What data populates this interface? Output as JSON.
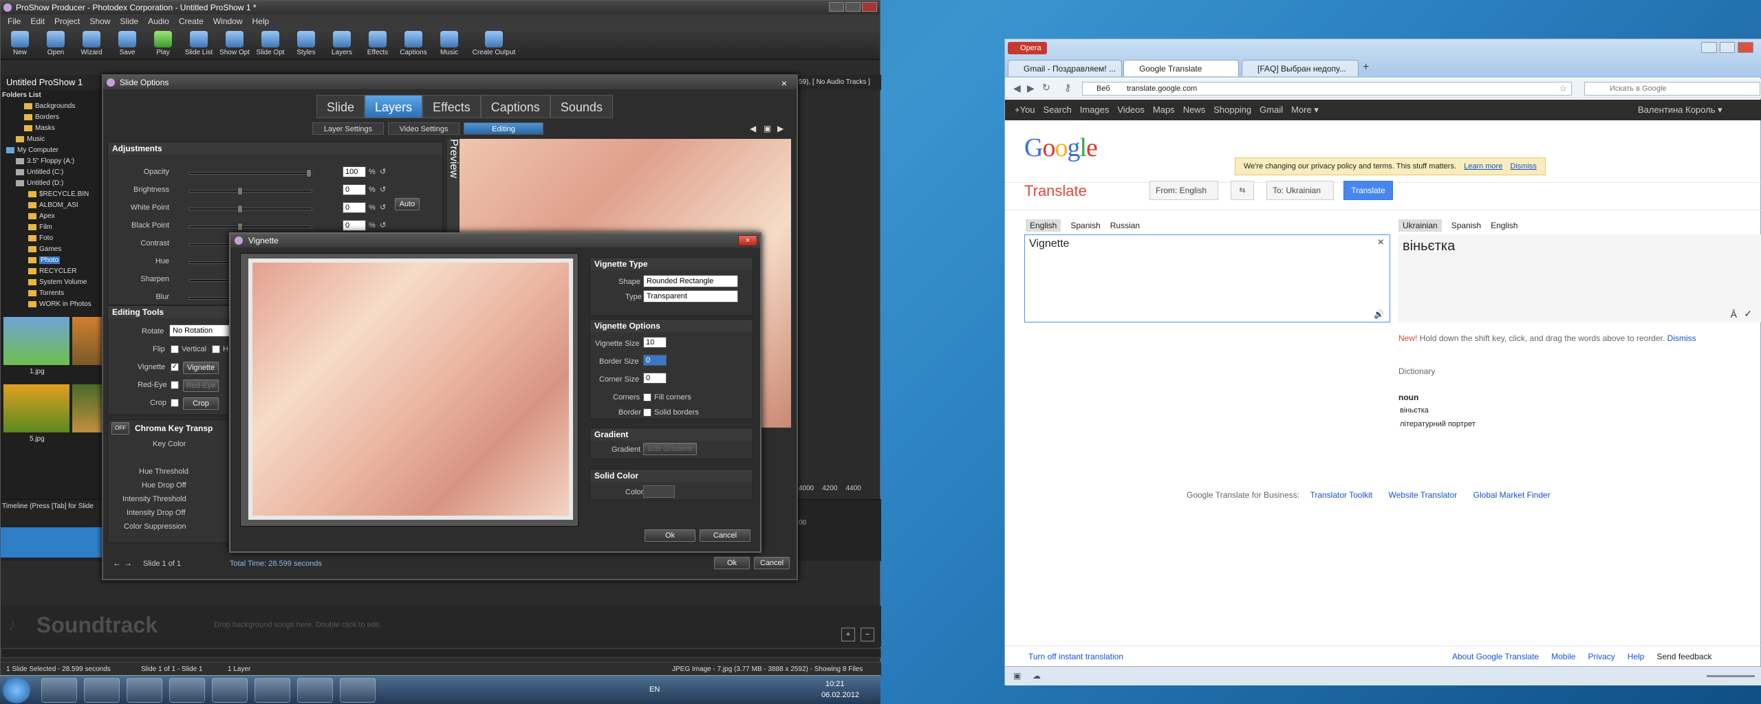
{
  "proshow": {
    "title": "ProShow Producer - Photodex Corporation - Untitled ProShow 1 *",
    "menu": [
      "File",
      "Edit",
      "Project",
      "Show",
      "Slide",
      "Audio",
      "Create",
      "Window",
      "Help"
    ],
    "toolbar": [
      "New",
      "Open",
      "Wizard",
      "Save",
      "Play",
      "Slide List",
      "Show Opt",
      "Slide Opt",
      "Styles",
      "Layers",
      "Effects",
      "Captions",
      "Music",
      "Create Output"
    ],
    "show_name": "Untitled ProShow 1",
    "show_info": "59), [ No Audio Tracks ]",
    "folders_title": "Folders List",
    "folders": [
      "Backgrounds",
      "Borders",
      "Masks",
      "Music",
      "My Computer",
      "3.5\" Floppy (A:)",
      "Untitled (C:)",
      "Untitled (D:)",
      "$RECYCLE.BIN",
      "ALBOM_ASI",
      "Apex",
      "Film",
      "Foto",
      "Games",
      "Photo",
      "RECYCLER",
      "System Volume",
      "Torrents",
      "WORK in Photos"
    ],
    "thumbs": [
      "1.jpg",
      "5.jpg"
    ],
    "timeline_label": "Timeline (Press [Tab] for Slide",
    "ruler": [
      "4000",
      "4200",
      "4400"
    ],
    "ruler_short": "00",
    "soundtrack": "Soundtrack",
    "soundtrack_hint": "Drop background songs here.  Double click to edit.",
    "status_left": "1 Slide Selected - 28.599 seconds",
    "status_mid": "Slide 1 of 1 - Slide 1",
    "status_layers": "1 Layer",
    "status_right": "JPEG Image - 7.jpg (3.77 MB - 3888 x 2592) - Showing 8 Files"
  },
  "slide_options": {
    "title": "Slide Options",
    "tabs": [
      "Slide",
      "Layers",
      "Effects",
      "Captions",
      "Sounds"
    ],
    "subtabs": [
      "Layer Settings",
      "Video Settings",
      "Editing"
    ],
    "preview_label": "Preview",
    "adjustments_title": "Adjustments",
    "adjust": [
      {
        "label": "Opacity",
        "value": "100",
        "unit": "%"
      },
      {
        "label": "Brightness",
        "value": "0",
        "unit": "%"
      },
      {
        "label": "White Point",
        "value": "0",
        "unit": "%"
      },
      {
        "label": "Black Point",
        "value": "0",
        "unit": "%"
      },
      {
        "label": "Contrast"
      },
      {
        "label": "Hue"
      },
      {
        "label": "Sharpen"
      },
      {
        "label": "Blur"
      }
    ],
    "auto": "Auto",
    "editing_tools": "Editing Tools",
    "rotate_label": "Rotate",
    "rotate_value": "No Rotation",
    "flip_label": "Flip",
    "vertical": "Vertical",
    "horizontal": "H",
    "vignette_label": "Vignette",
    "vignette_btn": "Vignette",
    "redeye_label": "Red-Eye",
    "redeye_btn": "Red-Eye",
    "crop_label": "Crop",
    "crop_btn": "Crop",
    "chroma_toggle": "OFF",
    "chroma": "Chroma Key Transp",
    "key_color": "Key Color",
    "chroma_rows": [
      "Hue Threshold",
      "Hue Drop Off",
      "Intensity Threshold",
      "Intensity Drop Off",
      "Color Suppression"
    ],
    "slide_nav": "Slide 1 of 1",
    "total_time": "Total Time: 28.599 seconds",
    "ok": "Ok",
    "cancel": "Cancel"
  },
  "vignette": {
    "title": "Vignette",
    "type_title": "Vignette Type",
    "shape_label": "Shape",
    "shape_value": "Rounded Rectangle",
    "type_label": "Type",
    "type_value": "Transparent",
    "options_title": "Vignette Options",
    "size_label": "Vignette Size",
    "size_value": "10",
    "border_label": "Border Size",
    "border_value": "0",
    "corner_label": "Corner Size",
    "corner_value": "0",
    "corners_label": "Corners",
    "fill_corners": "Fill corners",
    "border_chk_label": "Border",
    "solid_borders": "Solid borders",
    "gradient_title": "Gradient",
    "gradient_label": "Gradient",
    "gradient_btn": "Edit Gradient",
    "solid_title": "Solid Color",
    "color_label": "Color",
    "ok": "Ok",
    "cancel": "Cancel"
  },
  "opera": {
    "app": "Opera",
    "tabs": [
      "Gmail - Поздравляем! ...",
      "Google Translate",
      "[FAQ] Выбран недопу..."
    ],
    "back_label": "Веб",
    "url": "translate.google.com",
    "search_placeholder": "Искать в Google",
    "gbar": [
      "+You",
      "Search",
      "Images",
      "Videos",
      "Maps",
      "News",
      "Shopping",
      "Gmail",
      "More ▾"
    ],
    "user": "Валентина Король ▾",
    "notice": "We're changing our privacy policy and terms. This stuff matters.",
    "learn_more": "Learn more",
    "dismiss": "Dismiss",
    "translate_title": "Translate",
    "from": "From: English",
    "to": "To: Ukrainian",
    "translate_btn": "Translate",
    "src_langs": [
      "English",
      "Spanish",
      "Russian"
    ],
    "dst_langs": [
      "Ukrainian",
      "Spanish",
      "English"
    ],
    "source_text": "Vignette",
    "result": "віньєтка",
    "tip_new": "New!",
    "tip": "Hold down the shift key, click, and drag the words above to reorder.",
    "tip_dismiss": "Dismiss",
    "dictionary": "Dictionary",
    "pos": "noun",
    "meanings": [
      "віньєтка",
      "літературний портрет"
    ],
    "business": "Google Translate for Business:",
    "links": [
      "Translator Toolkit",
      "Website Translator",
      "Global Market Finder"
    ],
    "footer_left": "Turn off instant translation",
    "footer_links": [
      "About Google Translate",
      "Mobile",
      "Privacy",
      "Help"
    ],
    "feedback": "Send feedback"
  },
  "taskbar": {
    "lang": "EN",
    "time": "10:21",
    "date": "06.02.2012"
  }
}
